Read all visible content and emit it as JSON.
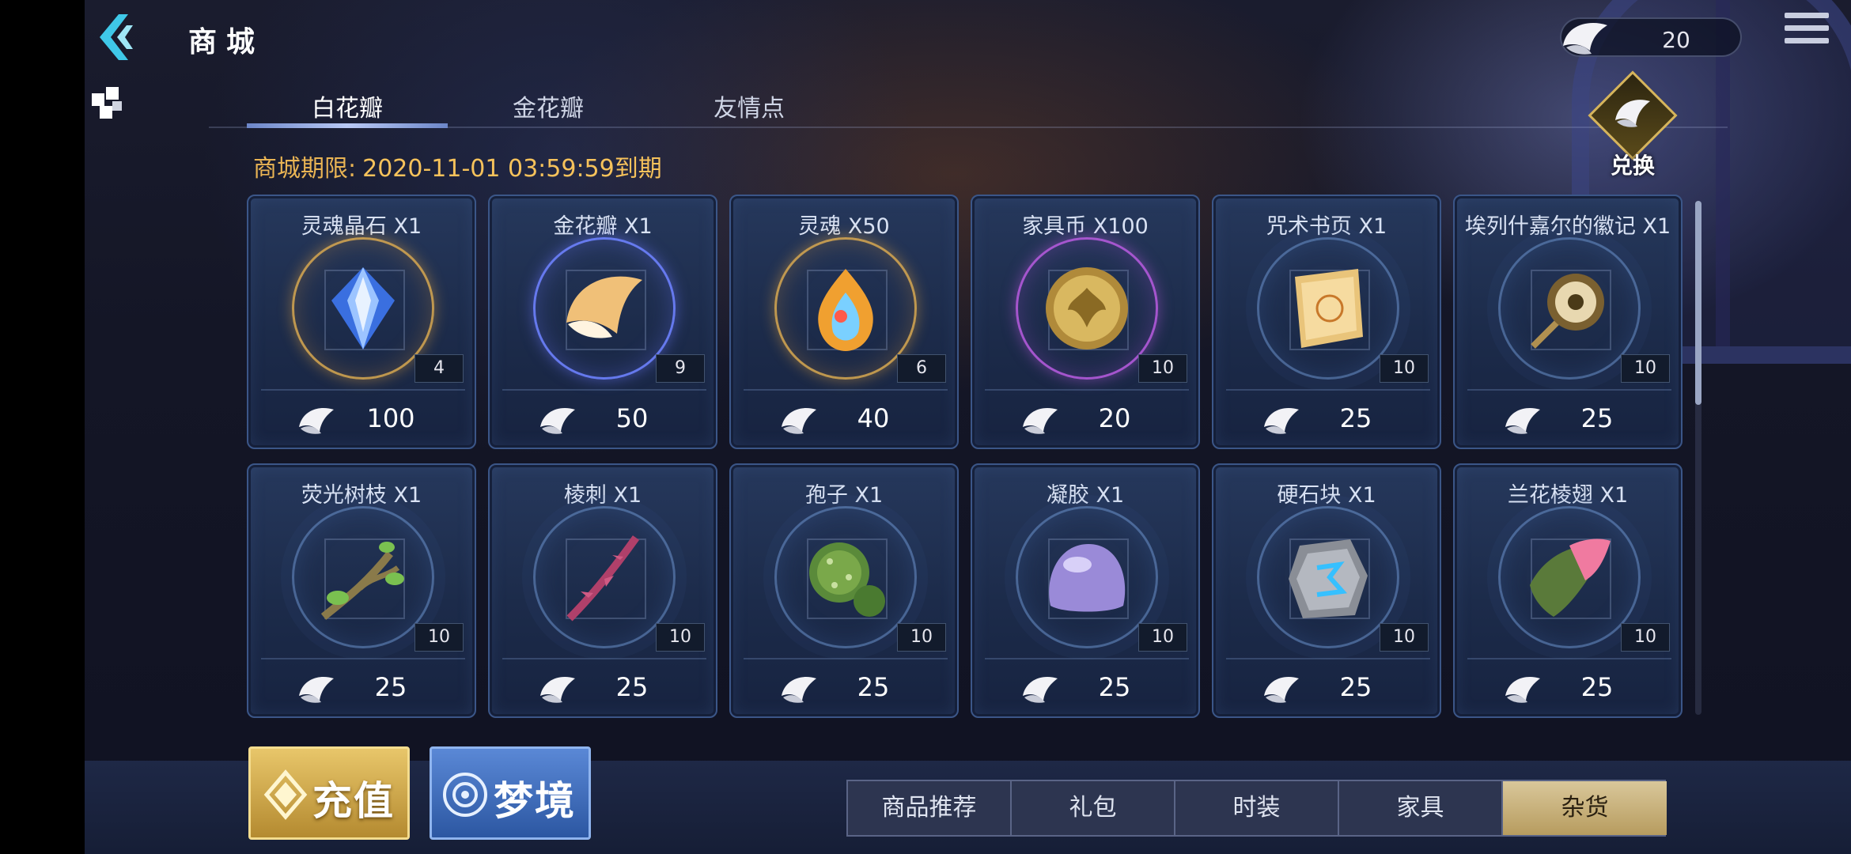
{
  "header": {
    "title": "商城",
    "currency_value": "20"
  },
  "tabs": [
    {
      "label": "白花瓣",
      "active": true
    },
    {
      "label": "金花瓣",
      "active": false
    },
    {
      "label": "友情点",
      "active": false
    }
  ],
  "exchange_label": "兑换",
  "deadline": {
    "label": "商城期限:",
    "date": "2020-11-01 03:59:59到期"
  },
  "items": [
    {
      "name": "灵魂晶石 X1",
      "stock": "4",
      "price": "100",
      "icon": "soul-crystal-icon",
      "ring": "gold"
    },
    {
      "name": "金花瓣 X1",
      "stock": "9",
      "price": "50",
      "icon": "gold-petal-icon",
      "ring": "blue"
    },
    {
      "name": "灵魂 X50",
      "stock": "6",
      "price": "40",
      "icon": "soul-gem-icon",
      "ring": "gold"
    },
    {
      "name": "家具币 X100",
      "stock": "10",
      "price": "20",
      "icon": "furniture-coin-icon",
      "ring": "purple"
    },
    {
      "name": "咒术书页 X1",
      "stock": "10",
      "price": "25",
      "icon": "spell-page-icon",
      "ring": "normal"
    },
    {
      "name": "埃列什嘉尔的徽记 X1",
      "stock": "10",
      "price": "25",
      "icon": "emblem-icon",
      "ring": "normal"
    },
    {
      "name": "荧光树枝 X1",
      "stock": "10",
      "price": "25",
      "icon": "glowing-branch-icon",
      "ring": "normal"
    },
    {
      "name": "棱刺 X1",
      "stock": "10",
      "price": "25",
      "icon": "thorn-icon",
      "ring": "normal"
    },
    {
      "name": "孢子 X1",
      "stock": "10",
      "price": "25",
      "icon": "spore-icon",
      "ring": "normal"
    },
    {
      "name": "凝胶 X1",
      "stock": "10",
      "price": "25",
      "icon": "gel-icon",
      "ring": "normal"
    },
    {
      "name": "硬石块 X1",
      "stock": "10",
      "price": "25",
      "icon": "hard-stone-icon",
      "ring": "normal"
    },
    {
      "name": "兰花棱翅 X1",
      "stock": "10",
      "price": "25",
      "icon": "orchid-wing-icon",
      "ring": "normal"
    }
  ],
  "bottom": {
    "recharge_label": "充值",
    "dream_label": "梦境",
    "categories": [
      {
        "label": "商品推荐",
        "active": false
      },
      {
        "label": "礼包",
        "active": false
      },
      {
        "label": "时装",
        "active": false
      },
      {
        "label": "家具",
        "active": false
      },
      {
        "label": "杂货",
        "active": true
      }
    ]
  },
  "colors": {
    "accent_gold": "#f6c25b",
    "card_border": "#3b5688",
    "active_category": "#d9c79a"
  }
}
